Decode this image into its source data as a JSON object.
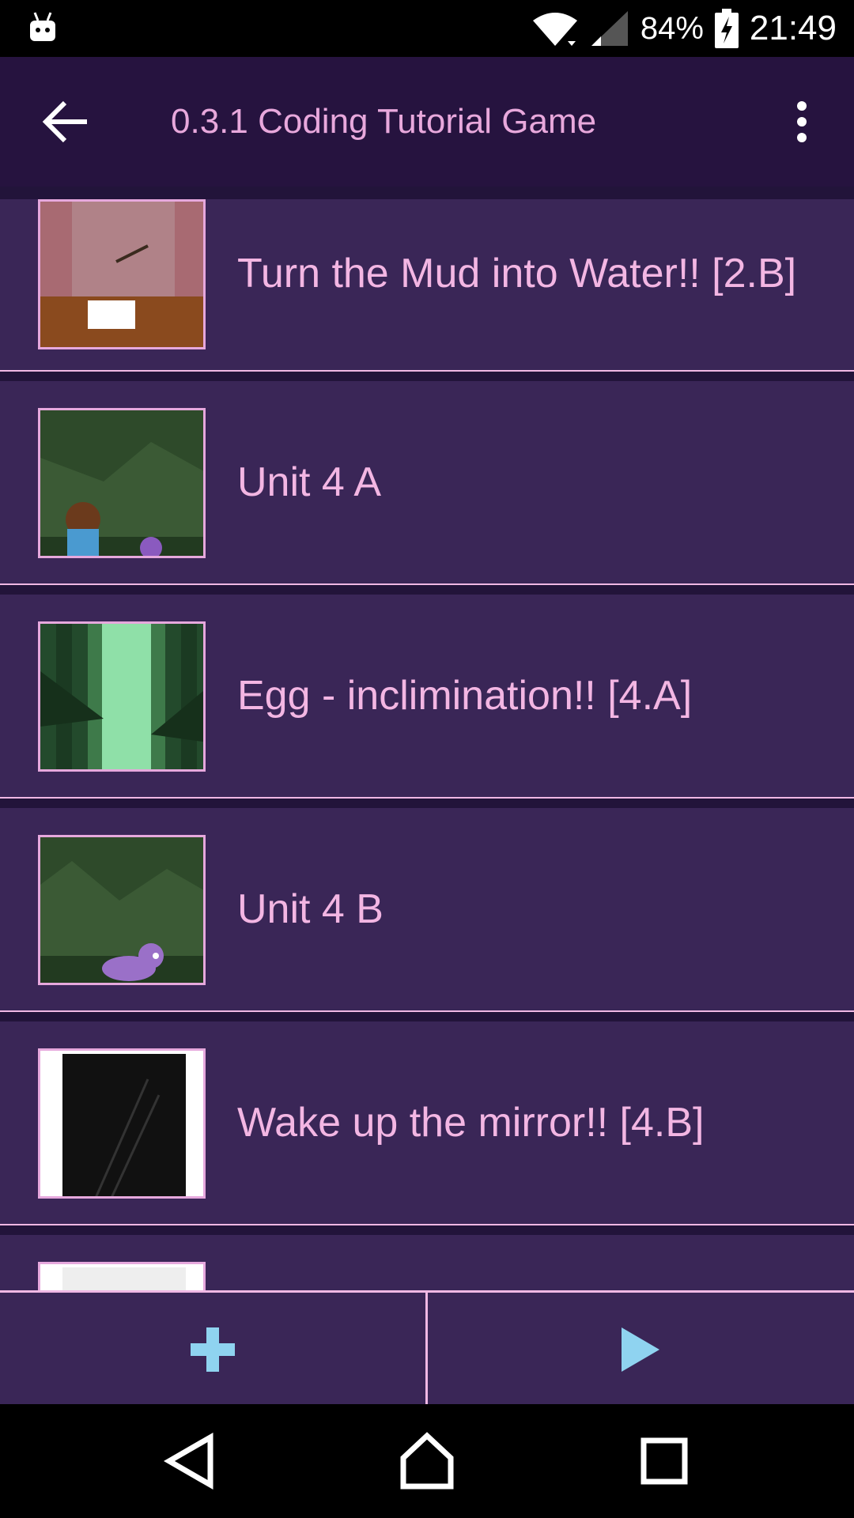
{
  "status_bar": {
    "battery": "84%",
    "time": "21:49",
    "icons": [
      "android-debug-icon",
      "wifi-icon",
      "cell-signal-icon",
      "battery-charging-icon"
    ]
  },
  "app_bar": {
    "title": "0.3.1 Coding Tutorial Game",
    "back_icon": "back-arrow-icon",
    "menu_icon": "more-vertical-icon"
  },
  "list": {
    "items": [
      {
        "label": "Turn the Mud into Water!! [2.B]"
      },
      {
        "label": "Unit 4 A"
      },
      {
        "label": "Egg - inclimination!! [4.A]"
      },
      {
        "label": "Unit 4 B"
      },
      {
        "label": "Wake up the mirror!! [4.B]"
      }
    ]
  },
  "bottom_bar": {
    "add_icon": "plus-icon",
    "play_icon": "play-icon",
    "accent": "#8fd3f0"
  },
  "nav_bar": {
    "icons": [
      "nav-back-icon",
      "nav-home-icon",
      "nav-recents-icon"
    ]
  },
  "colors": {
    "app_bar_bg": "#26133f",
    "list_item_bg": "#3a2657",
    "text_pink": "#f3b6e3",
    "divider_pink": "#f0b8e4"
  }
}
